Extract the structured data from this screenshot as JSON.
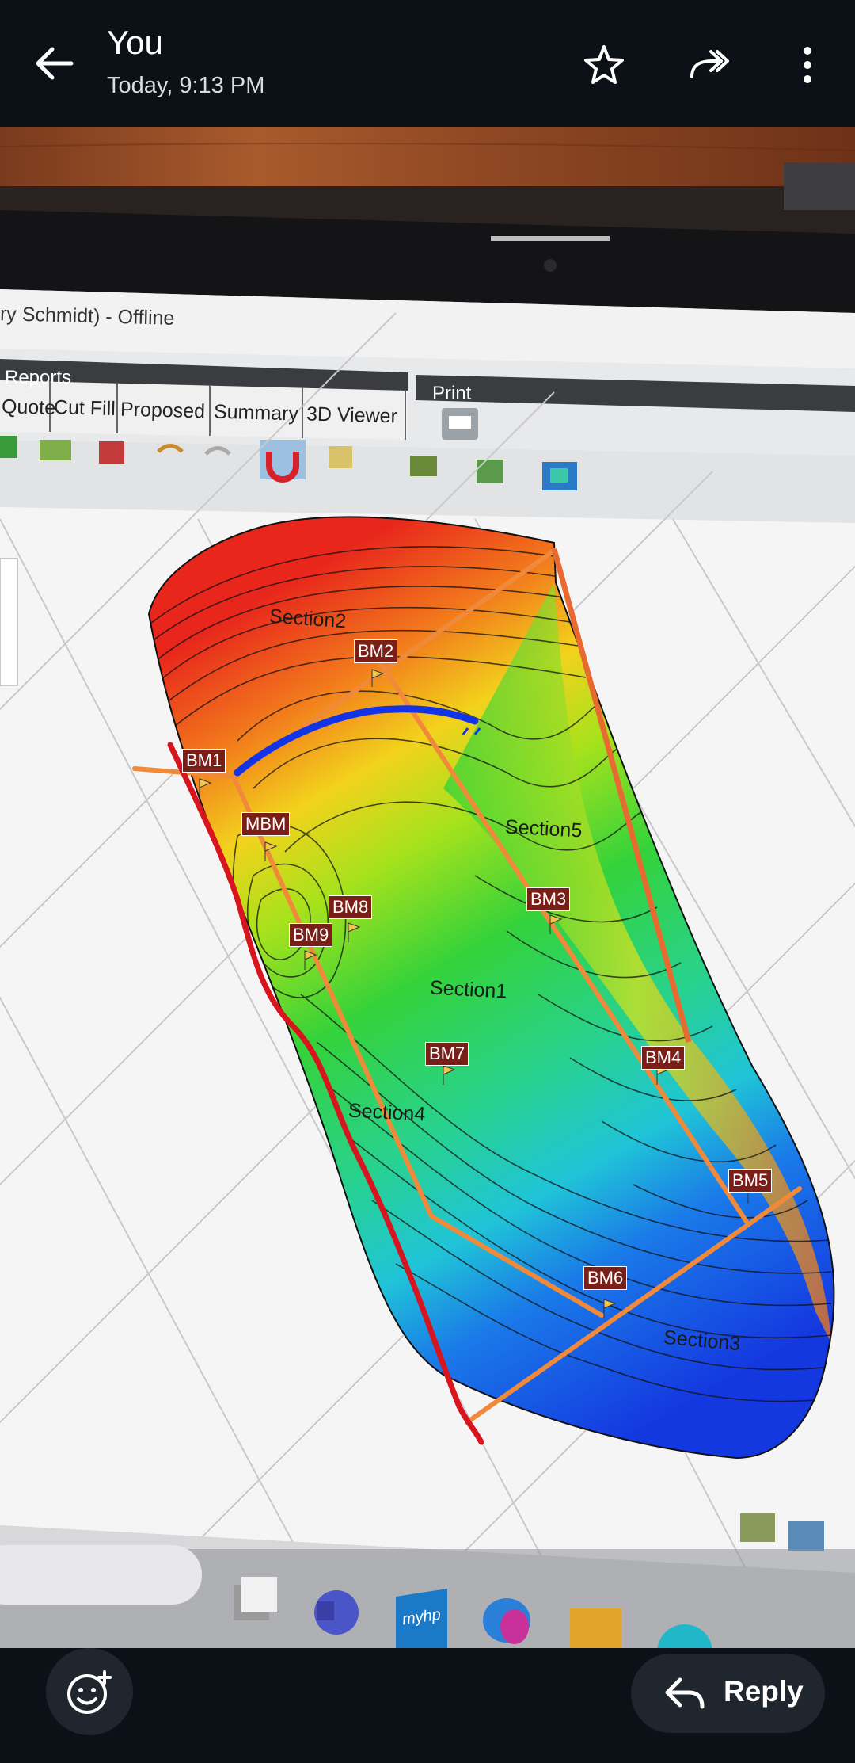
{
  "header": {
    "sender": "You",
    "timestamp": "Today, 9:13 PM",
    "icons": [
      "back-arrow-icon",
      "star-icon",
      "forward-icon",
      "more-vert-icon"
    ]
  },
  "photo": {
    "window_title": "ry Schmidt) - Offline",
    "menu_group": "Reports",
    "tabs": [
      "Quote",
      "Cut Fill",
      "Proposed",
      "Summary",
      "3D Viewer"
    ],
    "print_group": "Print",
    "taskbar_app": "myhp",
    "map_labels": {
      "section1": "Section1",
      "section2": "Section2",
      "section3": "Section3",
      "section4": "Section4",
      "section5": "Section5"
    },
    "benchmarks": [
      "BM1",
      "BM2",
      "BM3",
      "BM4",
      "BM5",
      "BM6",
      "BM7",
      "BM8",
      "BM9",
      "MBM"
    ]
  },
  "footer": {
    "reply_label": "Reply",
    "icons": [
      "add-reaction-icon",
      "reply-icon"
    ]
  },
  "colors": {
    "bar_background": "#0c1117",
    "pill_background": "#1f262d",
    "annotation_red": "#d8141e",
    "annotation_blue": "#1233e6",
    "section_line_orange": "#f08a3a"
  }
}
